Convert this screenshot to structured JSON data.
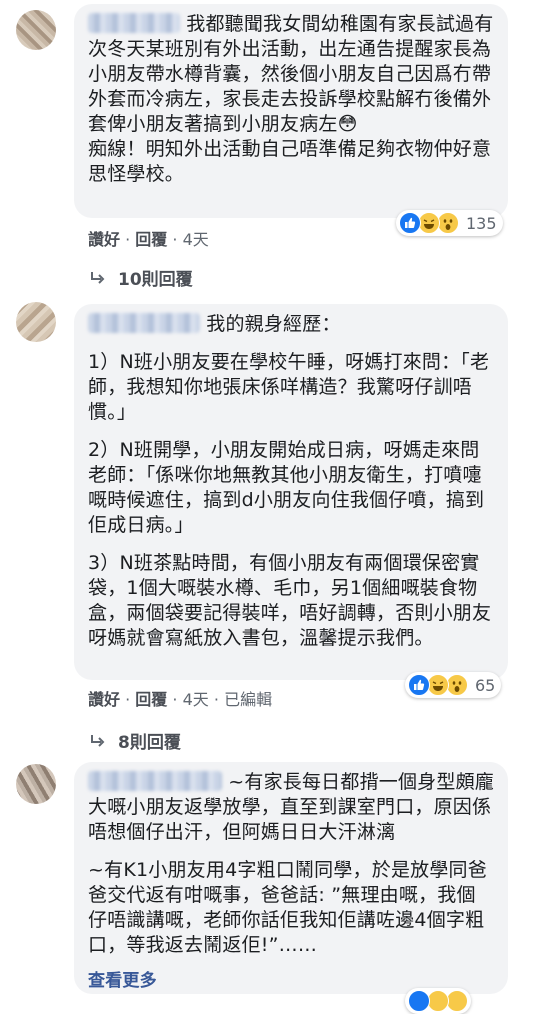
{
  "comments": [
    {
      "paragraphs": [
        "我都聽聞我女間幼稚園有家長試過有次冬天某班別有外出活動，出左通告提醒家長為小朋友帶水樽背囊，然後個小朋友自己因爲冇帶外套而冷病左，家長走去投訴學校點解冇後備外套俾小朋友著搞到小朋友病左😳",
        "痴線！明知外出活動自己唔準備足夠衣物仲好意思怪學校。"
      ],
      "actions": {
        "like": "讚好",
        "reply": "回覆",
        "time": "4天"
      },
      "reaction_count": "135",
      "replies_label": "10則回覆"
    },
    {
      "paragraphs": [
        "我的親身經歷：",
        "1）N班小朋友要在學校午睡，呀媽打來問：「老師，我想知你地張床係咩構造？我驚呀仔訓唔慣。」",
        "2）N班開學，小朋友開始成日病，呀媽走來問老師：「係咪你地無教其他小朋友衛生，打噴嚏嘅時候遮住，搞到d小朋友向住我個仔噴，搞到佢成日病。」",
        "3）N班茶點時間，有個小朋友有兩個環保密實袋，1個大嘅裝水樽、毛巾，另1個細嘅裝食物盒，兩個袋要記得裝咩，唔好調轉，否則小朋友呀媽就會寫紙放入書包，溫馨提示我們。"
      ],
      "actions": {
        "like": "讚好",
        "reply": "回覆",
        "time": "4天",
        "edited": "已編輯"
      },
      "reaction_count": "65",
      "replies_label": "8則回覆"
    },
    {
      "paragraphs": [
        "~有家長每日都揹一個身型頗龐大嘅小朋友返學放學，直至到課室門口，原因係唔想個仔出汗，但阿媽日日大汗淋漓",
        "~有K1小朋友用4字粗口鬧同學，於是放學同爸爸交代返有咁嘅事，爸爸話: ”無理由嘅，我個仔唔識講嘅，老師你話佢我知佢講咗邊4個字粗口，等我返去鬧返佢!”……"
      ],
      "see_more": "查看更多"
    }
  ]
}
